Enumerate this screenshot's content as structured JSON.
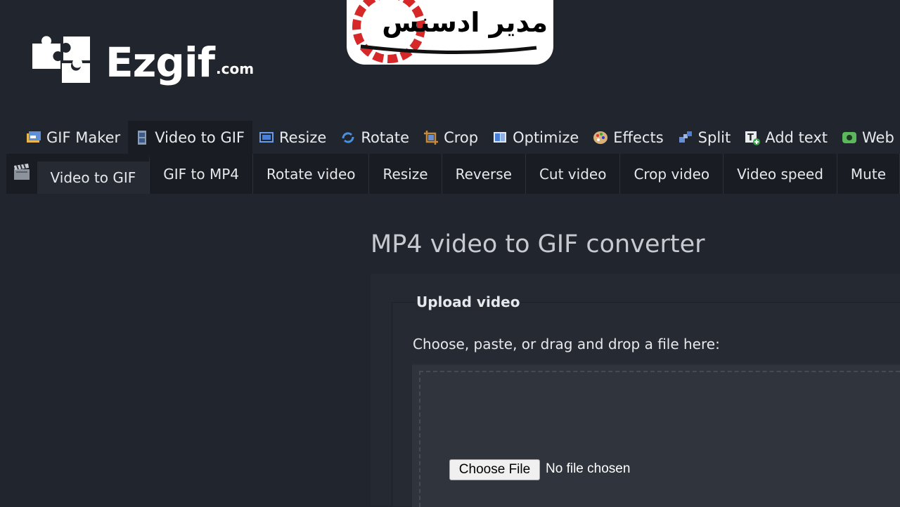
{
  "logo": {
    "name": "Ezgif",
    "domain": ".com"
  },
  "watermark": {
    "text": "مدير ادسنس"
  },
  "main_nav": [
    {
      "label": "GIF Maker",
      "icon": "gif-maker-icon",
      "active": false
    },
    {
      "label": "Video to GIF",
      "icon": "film-strip-icon",
      "active": true
    },
    {
      "label": "Resize",
      "icon": "resize-icon",
      "active": false
    },
    {
      "label": "Rotate",
      "icon": "rotate-icon",
      "active": false
    },
    {
      "label": "Crop",
      "icon": "crop-icon",
      "active": false
    },
    {
      "label": "Optimize",
      "icon": "optimize-icon",
      "active": false
    },
    {
      "label": "Effects",
      "icon": "palette-icon",
      "active": false
    },
    {
      "label": "Split",
      "icon": "split-icon",
      "active": false
    },
    {
      "label": "Add text",
      "icon": "add-text-icon",
      "active": false
    },
    {
      "label": "Web",
      "icon": "webp-icon",
      "active": false
    }
  ],
  "sub_nav": {
    "icon": "clapperboard-icon",
    "items": [
      {
        "label": "Video to GIF",
        "active": true
      },
      {
        "label": "GIF to MP4",
        "active": false
      },
      {
        "label": "Rotate video",
        "active": false
      },
      {
        "label": "Resize",
        "active": false
      },
      {
        "label": "Reverse",
        "active": false
      },
      {
        "label": "Cut video",
        "active": false
      },
      {
        "label": "Crop video",
        "active": false
      },
      {
        "label": "Video speed",
        "active": false
      },
      {
        "label": "Mute",
        "active": false
      }
    ]
  },
  "main": {
    "title": "MP4 video to GIF converter",
    "upload_legend": "Upload video",
    "instruction": "Choose, paste, or drag and drop a file here:",
    "choose_file_label": "Choose File",
    "file_status": "No file chosen"
  },
  "colors": {
    "background": "#21252d",
    "nav_active": "#191c22",
    "accent_blue": "#4a90d9",
    "accent_green": "#5cb85c"
  }
}
